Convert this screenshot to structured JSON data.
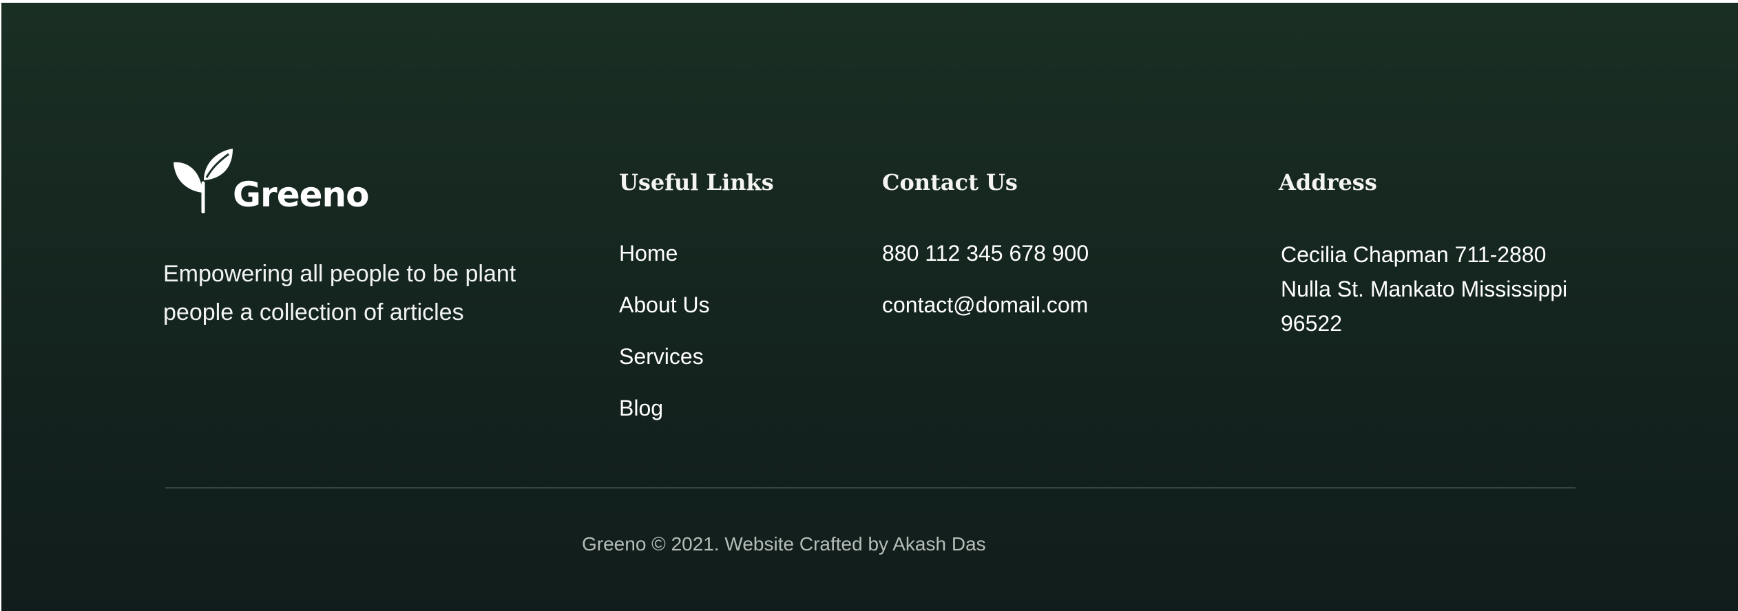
{
  "brand": {
    "name": "Greeno",
    "tagline": "Empowering all people to be plant people a collection of articles"
  },
  "useful_links": {
    "title": "Useful Links",
    "items": [
      {
        "label": "Home"
      },
      {
        "label": "About Us"
      },
      {
        "label": "Services"
      },
      {
        "label": "Blog"
      }
    ]
  },
  "contact": {
    "title": "Contact Us",
    "phone": "880 112 345 678 900",
    "email": "contact@domail.com"
  },
  "address": {
    "title": "Address",
    "text": "Cecilia Chapman 711-2880 Nulla St. Mankato Mississippi 96522"
  },
  "footer": {
    "copyright": "Greeno © 2021. Website Crafted by Akash Das"
  },
  "colors": {
    "background_top": "#1a2f24",
    "background_bottom": "#111d1c",
    "text": "#ffffff",
    "muted_text": "#b6bdb8",
    "divider": "#344640"
  }
}
